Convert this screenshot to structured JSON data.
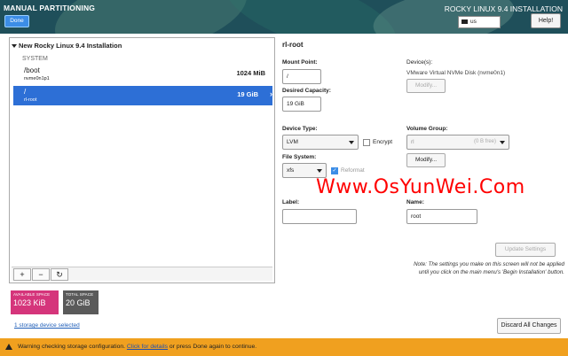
{
  "header": {
    "title": "MANUAL PARTITIONING",
    "done_label": "Done",
    "product": "ROCKY LINUX 9.4 INSTALLATION",
    "keyboard": "us",
    "help_label": "Help!"
  },
  "left": {
    "install_title": "New Rocky Linux 9.4 Installation",
    "system_label": "SYSTEM",
    "partitions": [
      {
        "mount": "/boot",
        "device": "nvme0n1p1",
        "size": "1024 MiB",
        "selected": false
      },
      {
        "mount": "/",
        "device": "rl-root",
        "size": "19 GiB",
        "selected": true
      }
    ],
    "toolbar": {
      "add": "+",
      "remove": "−",
      "refresh": "↻"
    }
  },
  "space": {
    "available_label": "AVAILABLE SPACE",
    "available_value": "1023 KiB",
    "total_label": "TOTAL SPACE",
    "total_value": "20 GiB"
  },
  "storage_link": "1 storage device selected",
  "right": {
    "title": "rl-root",
    "mount_point_label": "Mount Point:",
    "mount_point_value": "/",
    "desired_capacity_label": "Desired Capacity:",
    "desired_capacity_value": "19 GiB",
    "devices_label": "Device(s):",
    "devices_value": "VMware Virtual NVMe Disk (nvme0n1)",
    "modify_label": "Modify...",
    "device_type_label": "Device Type:",
    "device_type_value": "LVM",
    "encrypt_label": "Encrypt",
    "volume_group_label": "Volume Group:",
    "volume_group_value": "rl",
    "volume_group_free": "(0 B free)",
    "modify2_label": "Modify...",
    "file_system_label": "File System:",
    "file_system_value": "xfs",
    "reformat_label": "Reformat",
    "label_label": "Label:",
    "label_value": "",
    "name_label": "Name:",
    "name_value": "root",
    "update_label": "Update Settings",
    "note": "Note:  The settings you make on this screen will not be applied until you click on the main menu's 'Begin Installation' button."
  },
  "watermark": "Www.OsYunWei.Com",
  "discard_label": "Discard All Changes",
  "warning": {
    "before": "Warning checking storage configuration. ",
    "link": "Click for details",
    "after": " or press Done again to continue."
  }
}
